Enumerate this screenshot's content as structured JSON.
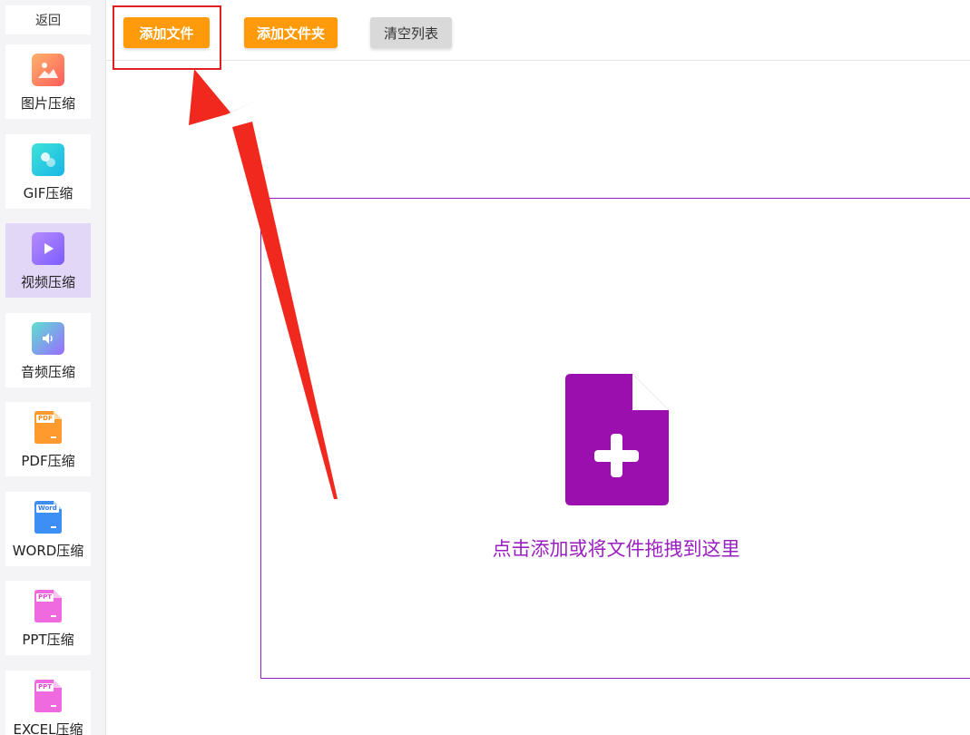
{
  "sidebar": {
    "back_label": "返回",
    "items": [
      {
        "label": "图片压缩",
        "icon": "image-icon"
      },
      {
        "label": "GIF压缩",
        "icon": "gif-icon"
      },
      {
        "label": "视频压缩",
        "icon": "video-play-icon",
        "active": true
      },
      {
        "label": "音频压缩",
        "icon": "audio-speaker-icon"
      },
      {
        "label": "PDF压缩",
        "icon": "pdf-file-icon",
        "tag": "PDF"
      },
      {
        "label": "WORD压缩",
        "icon": "word-file-icon",
        "tag": "Word"
      },
      {
        "label": "PPT压缩",
        "icon": "ppt-file-icon",
        "tag": "PPT"
      },
      {
        "label": "EXCEL压缩",
        "icon": "excel-file-icon",
        "tag": "PPT"
      }
    ]
  },
  "toolbar": {
    "add_file_label": "添加文件",
    "add_folder_label": "添加文件夹",
    "clear_list_label": "清空列表"
  },
  "dropzone": {
    "hint": "点击添加或将文件拖拽到这里"
  },
  "colors": {
    "accent_orange": "#ff9b0a",
    "accent_purple": "#9a1fc0",
    "annotation_red": "#e02020",
    "active_nav_bg": "#e3d7f7"
  }
}
